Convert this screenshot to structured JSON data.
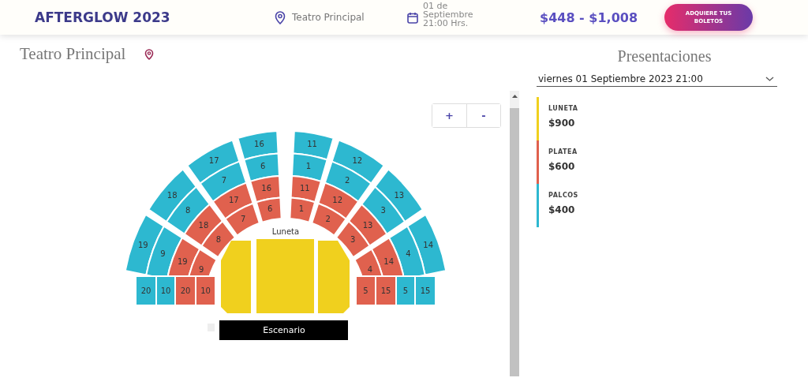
{
  "header": {
    "event_title": "AFTERGLOW 2023",
    "venue": "Teatro Principal",
    "date_lines": [
      "01 de",
      "Septiembre",
      "21:00 Hrs."
    ],
    "price_range": "$448 - $1,008",
    "cta_button": "ADQUIERE TUS BOLETOS"
  },
  "venue_section": {
    "venue_name": "Teatro Principal"
  },
  "seat_map": {
    "zoom_in": "+",
    "zoom_out": "-",
    "center_label": "Luneta",
    "stage_label": "Escenario",
    "left_wedges": [
      [
        {
          "label": "16",
          "kind": "palcos"
        },
        {
          "label": "6",
          "kind": "palcos"
        },
        {
          "label": "16",
          "kind": "platea"
        },
        {
          "label": "6",
          "kind": "platea"
        }
      ],
      [
        {
          "label": "17",
          "kind": "palcos"
        },
        {
          "label": "7",
          "kind": "palcos"
        },
        {
          "label": "17",
          "kind": "platea"
        },
        {
          "label": "7",
          "kind": "platea"
        }
      ],
      [
        {
          "label": "18",
          "kind": "palcos"
        },
        {
          "label": "8",
          "kind": "palcos"
        },
        {
          "label": "18",
          "kind": "platea"
        },
        {
          "label": "8",
          "kind": "platea"
        }
      ],
      [
        {
          "label": "19",
          "kind": "palcos"
        },
        {
          "label": "9",
          "kind": "palcos"
        },
        {
          "label": "19",
          "kind": "platea"
        },
        {
          "label": "9",
          "kind": "platea"
        }
      ]
    ],
    "right_wedges": [
      [
        {
          "label": "11",
          "kind": "palcos"
        },
        {
          "label": "1",
          "kind": "palcos"
        },
        {
          "label": "11",
          "kind": "platea"
        },
        {
          "label": "1",
          "kind": "platea"
        }
      ],
      [
        {
          "label": "12",
          "kind": "palcos"
        },
        {
          "label": "2",
          "kind": "palcos"
        },
        {
          "label": "12",
          "kind": "platea"
        },
        {
          "label": "2",
          "kind": "platea"
        }
      ],
      [
        {
          "label": "13",
          "kind": "palcos"
        },
        {
          "label": "3",
          "kind": "palcos"
        },
        {
          "label": "13",
          "kind": "platea"
        },
        {
          "label": "3",
          "kind": "platea"
        }
      ],
      [
        {
          "label": "14",
          "kind": "palcos"
        },
        {
          "label": "4",
          "kind": "palcos"
        },
        {
          "label": "14",
          "kind": "platea"
        },
        {
          "label": "4",
          "kind": "platea"
        }
      ]
    ],
    "left_band": [
      {
        "label": "20",
        "kind": "palcos"
      },
      {
        "label": "10",
        "kind": "palcos"
      },
      {
        "label": "20",
        "kind": "platea"
      },
      {
        "label": "10",
        "kind": "platea"
      }
    ],
    "right_band": [
      {
        "label": "5",
        "kind": "platea"
      },
      {
        "label": "15",
        "kind": "platea"
      },
      {
        "label": "5",
        "kind": "palcos"
      },
      {
        "label": "15",
        "kind": "palcos"
      }
    ]
  },
  "presentations": {
    "title": "Presentaciones",
    "selected_option": "viernes 01 Septiembre 2023 21:00"
  },
  "legend": [
    {
      "kind": "luneta",
      "name": "LUNETA",
      "price": "$900",
      "color": "#f0d01e"
    },
    {
      "kind": "platea",
      "name": "PLATEA",
      "price": "$600",
      "color": "#e0614e"
    },
    {
      "kind": "palcos",
      "name": "PALCOS",
      "price": "$400",
      "color": "#2db8d0"
    }
  ]
}
